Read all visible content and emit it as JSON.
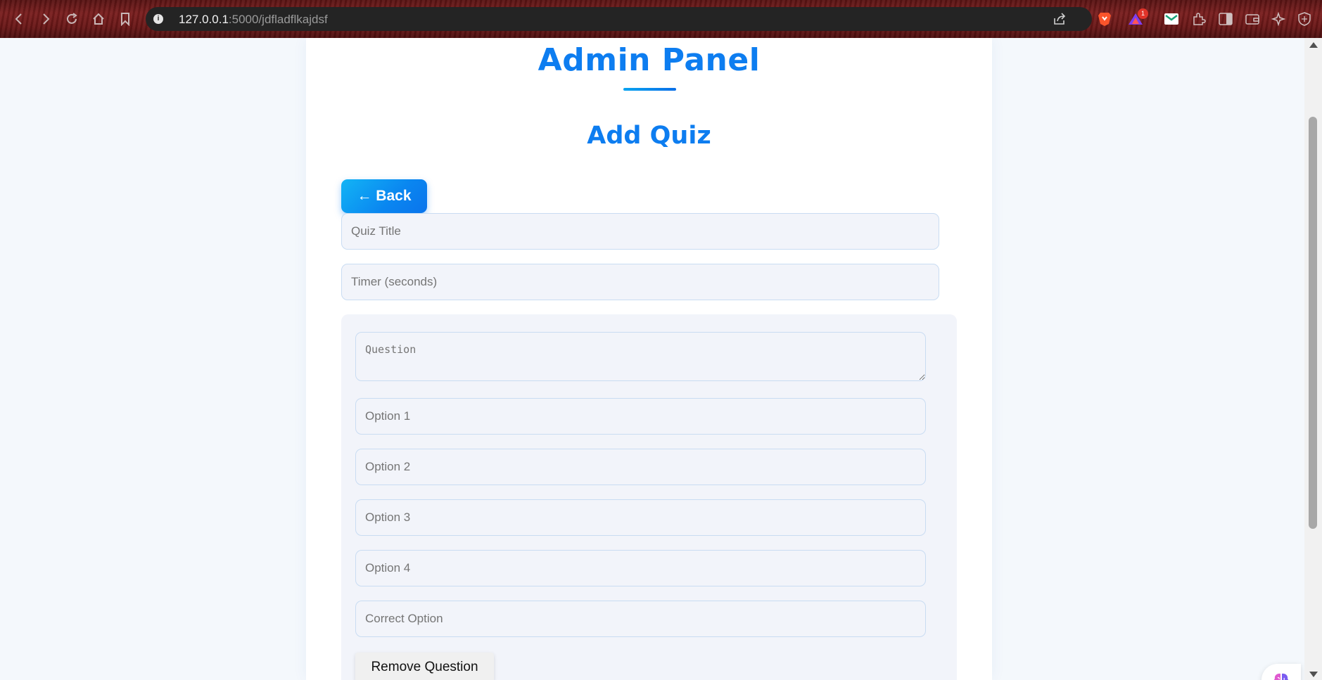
{
  "browser": {
    "url_host": "127.0.0.1",
    "url_rest": ":5000/jdfladflkajdsf",
    "icons": [
      "back-icon",
      "forward-icon",
      "reload-icon",
      "home-icon",
      "bookmark-icon",
      "site-info-icon",
      "share-icon",
      "brave-shields-icon",
      "brave-rewards-icon",
      "mail-extension-icon",
      "extensions-icon",
      "sidebar-icon",
      "wallet-icon",
      "leo-ai-icon",
      "vpn-icon"
    ],
    "rewards_badge": "1"
  },
  "page": {
    "title": "Admin Panel",
    "subtitle": "Add Quiz",
    "back_label": "← Back",
    "quiz_title_placeholder": "Quiz Title",
    "timer_placeholder": "Timer (seconds)",
    "question": {
      "question_placeholder": "Question",
      "options": [
        {
          "placeholder": "Option 1"
        },
        {
          "placeholder": "Option 2"
        },
        {
          "placeholder": "Option 3"
        },
        {
          "placeholder": "Option 4"
        }
      ],
      "correct_placeholder": "Correct Option",
      "remove_label": "Remove Question"
    }
  },
  "colors": {
    "accent": "#0d7df0",
    "button_gradient_start": "#13b4f5",
    "button_gradient_end": "#0a74ec",
    "page_bg": "#f4f8fc",
    "field_bg": "#f2f4fa",
    "field_border": "#c9dcf2"
  }
}
